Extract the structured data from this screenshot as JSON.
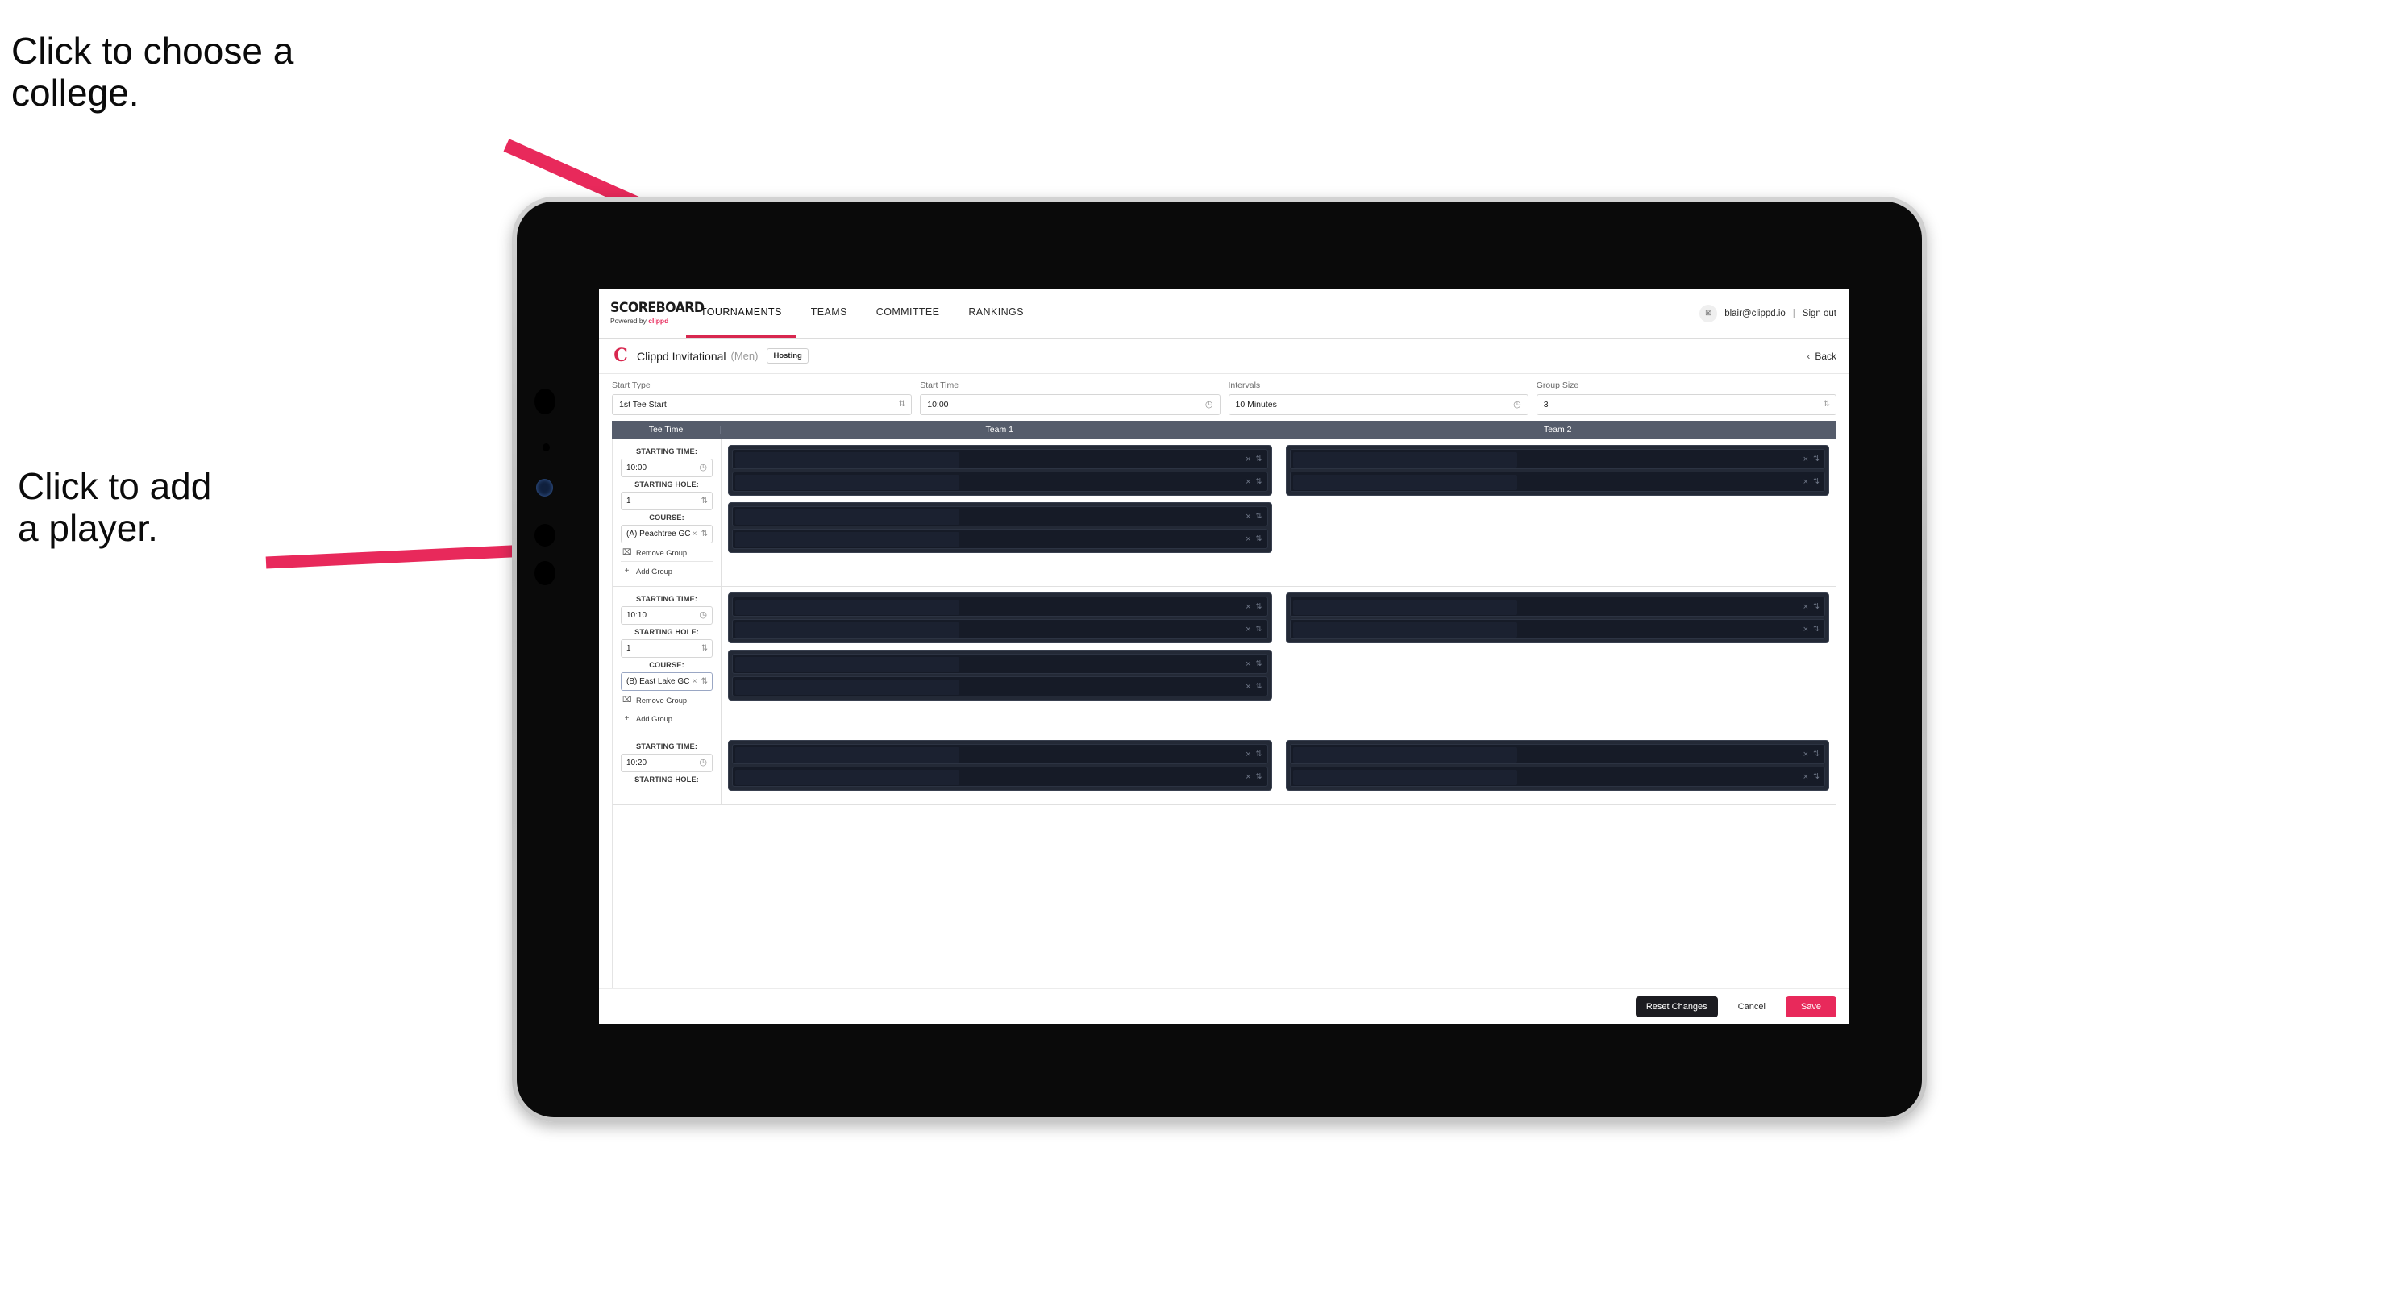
{
  "annotations": {
    "college": "Click to choose a\ncollege.",
    "player": "Click to add\na player."
  },
  "colors": {
    "accent": "#e8295b",
    "nav_active_underline": "#d8274f",
    "table_header_bg": "#555c6b",
    "card_bg": "#232936",
    "row_bg": "#161b27",
    "reset_button_bg": "#1c1c21"
  },
  "topnav": {
    "brand_title": "SCOREBOARD",
    "brand_sub_prefix": "Powered by ",
    "brand_sub_name": "clippd",
    "tabs": [
      {
        "label": "TOURNAMENTS",
        "active": true
      },
      {
        "label": "TEAMS",
        "active": false
      },
      {
        "label": "COMMITTEE",
        "active": false
      },
      {
        "label": "RANKINGS",
        "active": false
      }
    ],
    "avatar_glyph": "⊠",
    "user_email": "blair@clippd.io",
    "separator": "|",
    "sign_out": "Sign out"
  },
  "tournament_bar": {
    "logo_letter": "C",
    "name": "Clippd Invitational",
    "gender": "(Men)",
    "status_badge": "Hosting",
    "back_chevron": "‹",
    "back_label": "Back"
  },
  "settings": {
    "fields": [
      {
        "label": "Start Type",
        "value": "1st Tee Start",
        "icon": "stepper"
      },
      {
        "label": "Start Time",
        "value": "10:00",
        "icon": "clock"
      },
      {
        "label": "Intervals",
        "value": "10 Minutes",
        "icon": "clock"
      },
      {
        "label": "Group Size",
        "value": "3",
        "icon": "stepper"
      }
    ],
    "clock_glyph": "◷",
    "stepper_glyph": "⇅"
  },
  "table": {
    "headers": {
      "tee_time": "Tee Time",
      "team1": "Team 1",
      "team2": "Team 2"
    },
    "labels": {
      "starting_time": "STARTING TIME:",
      "starting_hole": "STARTING HOLE:",
      "course": "COURSE:",
      "remove_group": "Remove Group",
      "add_group": "Add Group"
    },
    "glyphs": {
      "clock": "◷",
      "stepper": "⇅",
      "clear": "×",
      "trash": "⌧",
      "plus": "+"
    },
    "groups": [
      {
        "starting_time": "10:00",
        "starting_hole": "1",
        "course": "(A) Peachtree GC",
        "course_focused": false,
        "team1_cards": [
          {
            "rows": 2
          },
          {
            "rows": 2
          }
        ],
        "team2_cards": [
          {
            "rows": 2
          }
        ]
      },
      {
        "starting_time": "10:10",
        "starting_hole": "1",
        "course": "(B) East Lake GC",
        "course_focused": true,
        "team1_cards": [
          {
            "rows": 2
          },
          {
            "rows": 2
          }
        ],
        "team2_cards": [
          {
            "rows": 2
          }
        ]
      },
      {
        "starting_time": "10:20",
        "starting_hole": "",
        "course": "",
        "course_focused": false,
        "team1_cards": [
          {
            "rows": 2
          }
        ],
        "team2_cards": [
          {
            "rows": 2
          }
        ]
      }
    ]
  },
  "footer": {
    "reset_label": "Reset Changes",
    "cancel_label": "Cancel",
    "save_label": "Save"
  }
}
